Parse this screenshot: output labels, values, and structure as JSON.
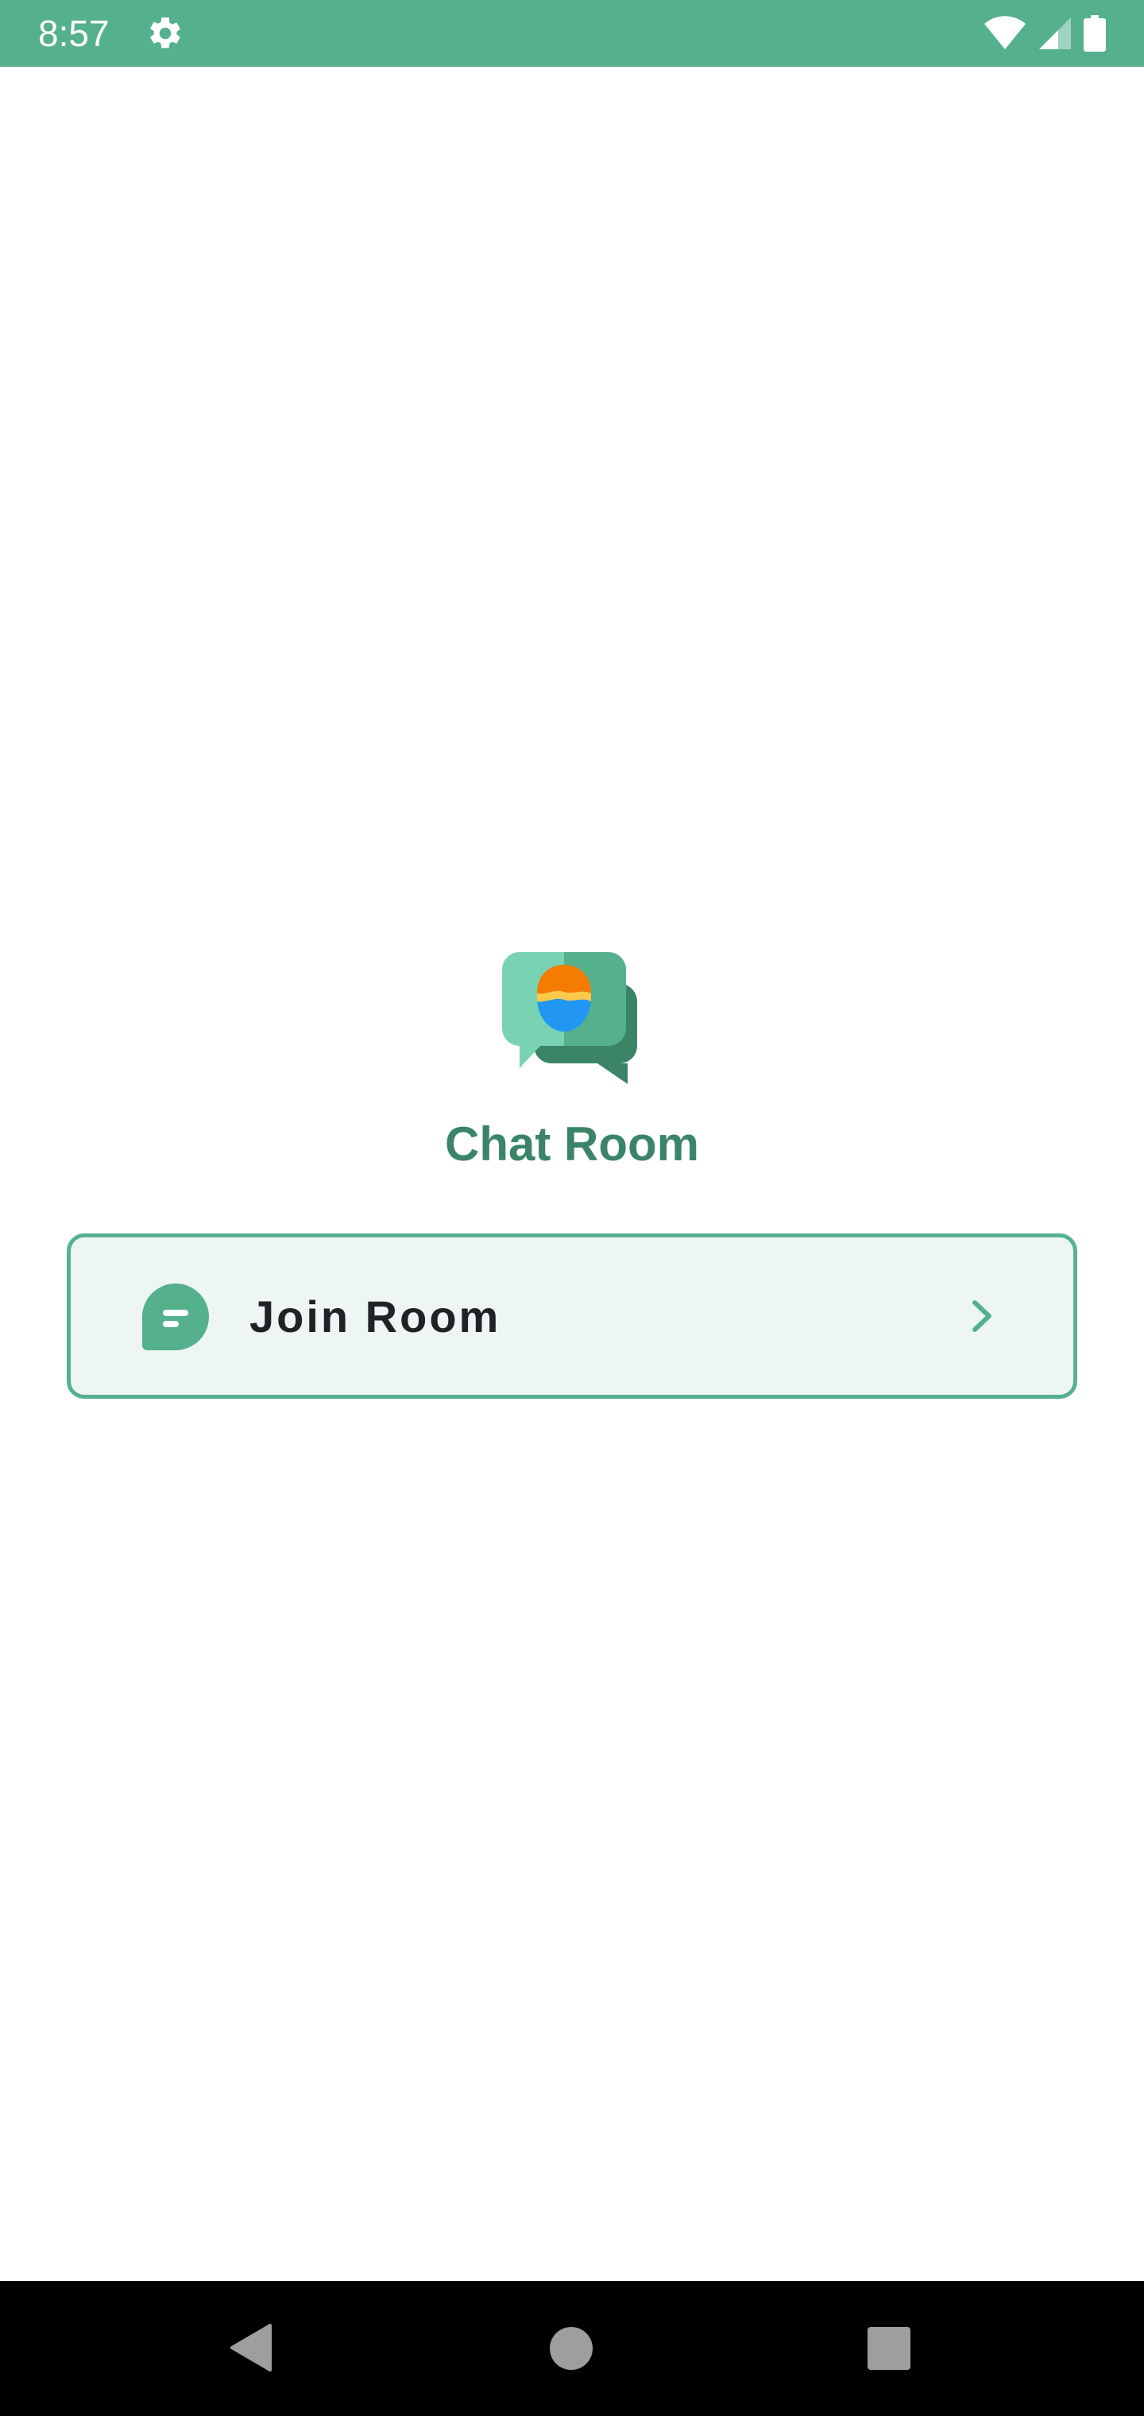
{
  "status_bar": {
    "time": "8:57",
    "icons": [
      "gear-icon",
      "wifi-icon",
      "cellular-signal-icon",
      "battery-icon"
    ],
    "background_color": "#55b08e"
  },
  "app": {
    "title": "Chat Room",
    "logo_icon": "chat-bubbles-logo-icon",
    "title_color": "#3b8468"
  },
  "join_room": {
    "label": "Join Room",
    "icon": "message-bubble-icon",
    "trailing_icon": "chevron-right-icon",
    "border_color": "#55b08e",
    "background_color": "#eef6f3"
  },
  "navigation_bar": {
    "buttons": [
      "back-icon",
      "home-icon",
      "recents-icon"
    ]
  }
}
